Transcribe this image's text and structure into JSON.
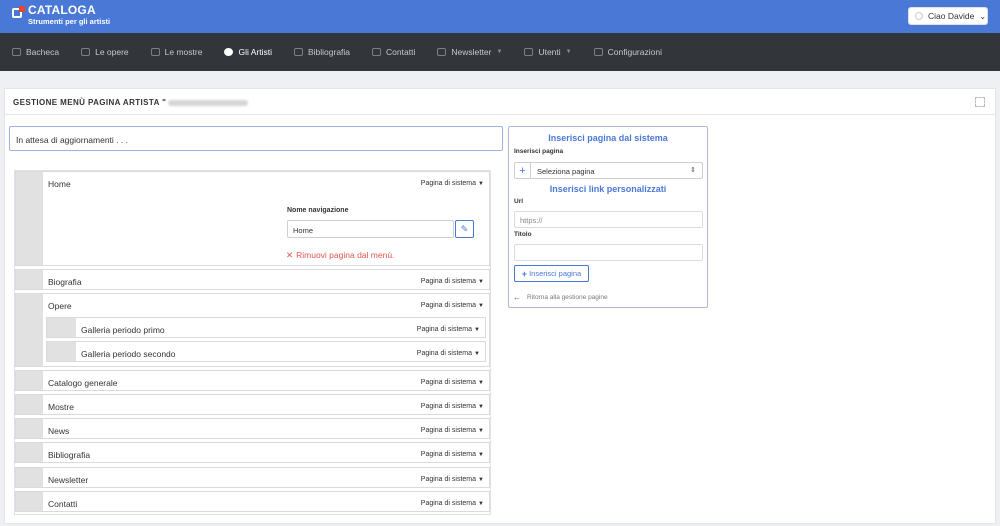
{
  "brand": {
    "title": "CATALOGA",
    "subtitle": "Strumenti per gli artisti"
  },
  "user": {
    "label": "Ciao Davide"
  },
  "nav": [
    {
      "label": "Bacheca",
      "icon": "gauge-icon"
    },
    {
      "label": "Le opere",
      "icon": "image-icon"
    },
    {
      "label": "Le mostre",
      "icon": "brush-icon"
    },
    {
      "label": "Gli Artisti",
      "icon": "palette-icon",
      "active": true
    },
    {
      "label": "Bibliografia",
      "icon": "books-icon"
    },
    {
      "label": "Contatti",
      "icon": "address-book-icon"
    },
    {
      "label": "Newsletter",
      "icon": "mail-icon",
      "dropdown": true
    },
    {
      "label": "Utenti",
      "icon": "users-icon",
      "dropdown": true
    },
    {
      "label": "Configurazioni",
      "icon": "tools-icon"
    }
  ],
  "page": {
    "title": "GESTIONE MENÙ PAGINA ARTISTA \""
  },
  "status": "In attesa di aggiornamenti . . .",
  "menu": {
    "type_label": "Pagina di sistema",
    "nav_name_label": "Nome navigazione",
    "nav_name_value": "Home",
    "remove_label": "Rimuovi pagina dal menù.",
    "items": [
      {
        "label": "Home"
      },
      {
        "label": "Biografia"
      },
      {
        "label": "Opere"
      },
      {
        "label": "Galleria periodo primo"
      },
      {
        "label": "Galleria periodo secondo"
      },
      {
        "label": "Catalogo generale"
      },
      {
        "label": "Mostre"
      },
      {
        "label": "News"
      },
      {
        "label": "Bibliografia"
      },
      {
        "label": "Newsletter"
      },
      {
        "label": "Contatti"
      }
    ]
  },
  "side": {
    "heading_system": "Inserisci pagina dal sistema",
    "insert_page_label": "Inserisci pagina",
    "select_value": "Seleziona pagina",
    "heading_links": "Inserisci link personalizzati",
    "url_label": "Url",
    "url_placeholder": "https://",
    "title_label": "Titolo",
    "insert_button": "Inserisci pagina",
    "back_link": "Ritorna alla gestione pagine"
  }
}
